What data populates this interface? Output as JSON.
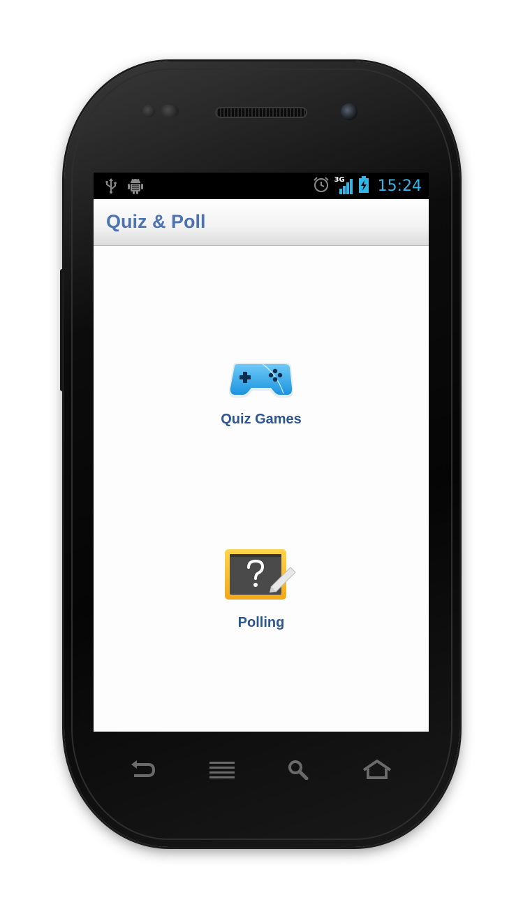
{
  "app": {
    "title": "Quiz & Poll"
  },
  "status_bar": {
    "time": "15:24",
    "network_label": "3G",
    "icons": [
      "usb-icon",
      "android-debug-icon",
      "alarm-icon",
      "signal-icon",
      "battery-charging-icon"
    ]
  },
  "menu": [
    {
      "label": "Quiz Games",
      "icon": "gamepad-icon"
    },
    {
      "label": "Polling",
      "icon": "chalkboard-question-icon"
    }
  ],
  "nav_buttons": [
    "back-icon",
    "menu-icon",
    "search-icon",
    "home-icon"
  ],
  "colors": {
    "title_text": "#4d74b0",
    "menu_label": "#2d5590",
    "status_accent": "#33b5e5"
  }
}
